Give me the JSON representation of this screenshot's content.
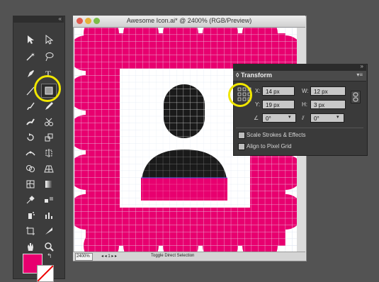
{
  "document": {
    "title": "Awesome Icon.ai* @ 2400% (RGB/Preview)",
    "zoom": "2400%",
    "status_text": "Toggle Direct Selection"
  },
  "transform_panel": {
    "title": "Transform",
    "x_label": "X:",
    "x_value": "14 px",
    "y_label": "Y:",
    "y_value": "19 px",
    "w_label": "W:",
    "w_value": "12 px",
    "h_label": "H:",
    "h_value": "3 px",
    "rotate_value": "0°",
    "shear_value": "0°",
    "scale_strokes_label": "Scale Strokes & Effects",
    "align_pixel_grid_label": "Align to Pixel Grid"
  },
  "colors": {
    "fill": "#e8006f",
    "icon_black": "#1a1a1a",
    "highlight_circle": "#f0e600"
  },
  "tools": [
    "selection-tool",
    "direct-selection-tool",
    "magic-wand-tool",
    "lasso-tool",
    "pen-tool",
    "type-tool",
    "line-segment-tool",
    "rectangle-tool",
    "paintbrush-tool",
    "pencil-tool",
    "blob-brush-tool",
    "eraser-tool",
    "rotate-tool",
    "scale-tool",
    "width-tool",
    "free-transform-tool",
    "shape-builder-tool",
    "perspective-grid-tool",
    "mesh-tool",
    "gradient-tool",
    "eyedropper-tool",
    "blend-tool",
    "symbol-sprayer-tool",
    "column-graph-tool",
    "artboard-tool",
    "slice-tool",
    "hand-tool",
    "zoom-tool"
  ]
}
